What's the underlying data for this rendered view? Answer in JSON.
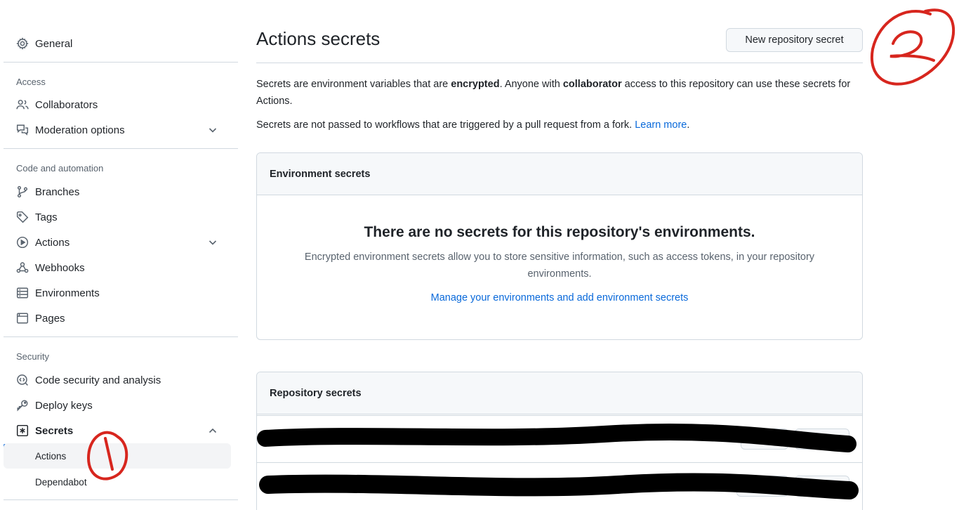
{
  "sidebar": {
    "general": {
      "label": "General",
      "icon": "gear-icon"
    },
    "access_heading": "Access",
    "collaborators": {
      "label": "Collaborators",
      "icon": "people-icon"
    },
    "moderation": {
      "label": "Moderation options",
      "icon": "comment-discussion-icon"
    },
    "code_heading": "Code and automation",
    "branches": {
      "label": "Branches",
      "icon": "git-branch-icon"
    },
    "tags": {
      "label": "Tags",
      "icon": "tag-icon"
    },
    "actions": {
      "label": "Actions",
      "icon": "play-icon"
    },
    "webhooks": {
      "label": "Webhooks",
      "icon": "webhook-icon"
    },
    "environments": {
      "label": "Environments",
      "icon": "server-icon"
    },
    "pages": {
      "label": "Pages",
      "icon": "browser-icon"
    },
    "security_heading": "Security",
    "code_security": {
      "label": "Code security and analysis",
      "icon": "codescan-icon"
    },
    "deploy_keys": {
      "label": "Deploy keys",
      "icon": "key-icon"
    },
    "secrets": {
      "label": "Secrets",
      "icon": "key-asterisk-icon"
    },
    "secrets_sub": [
      "Actions",
      "Dependabot"
    ],
    "active_item": "Actions"
  },
  "main": {
    "title": "Actions secrets",
    "new_button": "New repository secret",
    "desc1_a": "Secrets are environment variables that are ",
    "desc1_b": "encrypted",
    "desc1_c": ". Anyone with ",
    "desc1_d": "collaborator",
    "desc1_e": " access to this repository can use these secrets for Actions.",
    "desc2": "Secrets are not passed to workflows that are triggered by a pull request from a fork. ",
    "desc2_link": "Learn more",
    "desc2_end": ".",
    "env_box": {
      "header": "Environment secrets",
      "blank_title": "There are no secrets for this repository's environments.",
      "blank_desc": "Encrypted environment secrets allow you to store sensitive information, such as access tokens, in your repository environments.",
      "blank_link": "Manage your environments and add environment secrets"
    },
    "repo_box": {
      "header": "Repository secrets",
      "rows": 2
    }
  },
  "annotations": {
    "marker_1": "1",
    "marker_2": "2",
    "marker_color": "#d7261e"
  },
  "colors": {
    "accent": "#0969da",
    "border": "#d1d9e0",
    "header_bg": "#f6f8fa",
    "text": "#1f2328",
    "muted": "#59636e"
  }
}
